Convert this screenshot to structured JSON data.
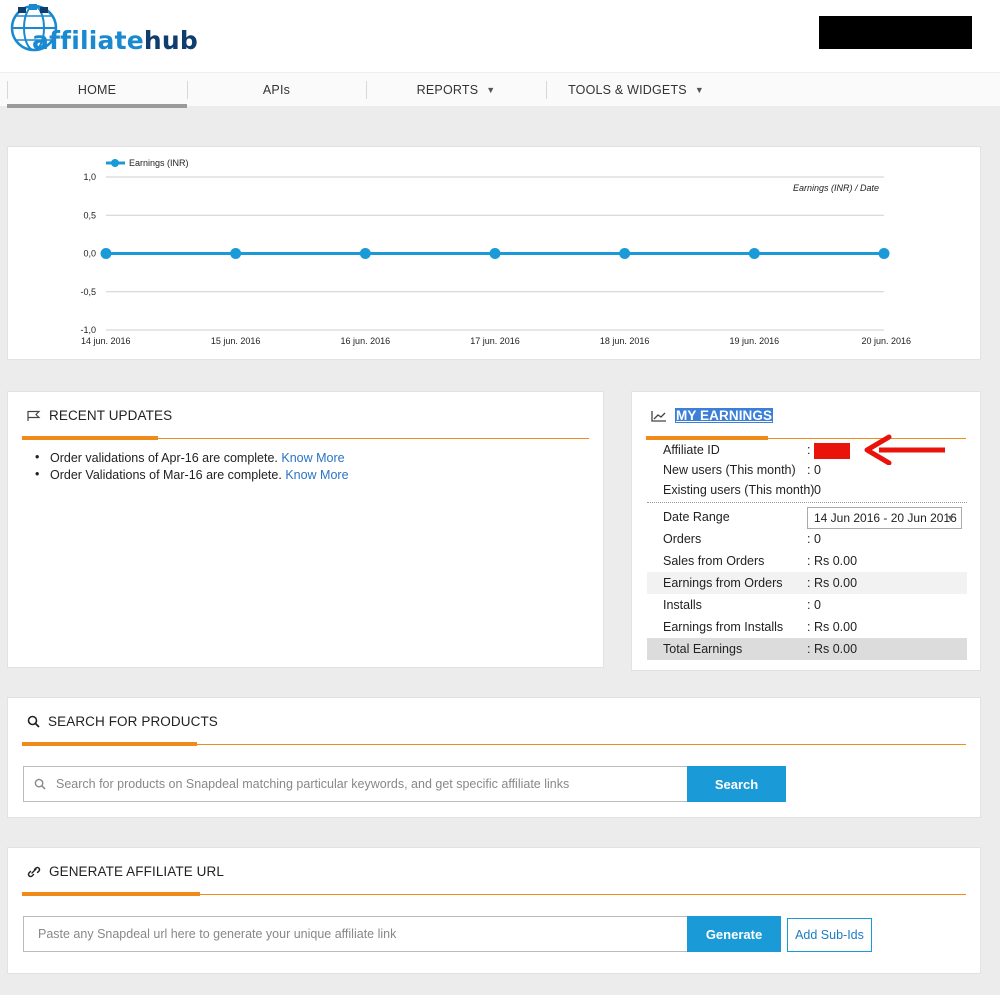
{
  "brand": {
    "aff": "affiliate",
    "hub": "hub"
  },
  "nav": {
    "items": [
      {
        "label": "HOME",
        "active": true
      },
      {
        "label": "APIs"
      },
      {
        "label": "REPORTS",
        "dropdown": true
      },
      {
        "label": "TOOLS & WIDGETS",
        "dropdown": true
      }
    ],
    "caret": "▼"
  },
  "chart_data": {
    "type": "line",
    "title": "Earnings (INR) / Date",
    "categories": [
      "14 jun. 2016",
      "15 jun. 2016",
      "16 jun. 2016",
      "17 jun. 2016",
      "18 jun. 2016",
      "19 jun. 2016",
      "20 jun. 2016"
    ],
    "series": [
      {
        "name": "Earnings (INR)",
        "values": [
          0,
          0,
          0,
          0,
          0,
          0,
          0
        ]
      }
    ],
    "yticks": [
      "1,0",
      "0,5",
      "0,0",
      "-0,5",
      "-1,0"
    ],
    "ylim": [
      -1,
      1
    ],
    "grid": true,
    "legend": "top-left",
    "color": "#1b9ad8"
  },
  "updates": {
    "title": "RECENT UPDATES",
    "items": [
      {
        "text": "Order validations of Apr-16 are complete.",
        "link": "Know More"
      },
      {
        "text": "Order Validations of Mar-16 are complete.",
        "link": "Know More"
      }
    ]
  },
  "earnings": {
    "title": "MY EARNINGS",
    "affiliate_id_label": "Affiliate ID",
    "new_users_label": "New users (This month)",
    "new_users_value": ": 0",
    "existing_users_label": "Existing users (This month)",
    "existing_users_value": ": 0",
    "date_range_label": "Date Range",
    "date_range_value": "14 Jun 2016 - 20 Jun 2016",
    "orders_label": "Orders",
    "orders_value": ": 0",
    "sales_label": "Sales from Orders",
    "sales_value": ": Rs 0.00",
    "earn_orders_label": "Earnings from Orders",
    "earn_orders_value": ": Rs 0.00",
    "installs_label": "Installs",
    "installs_value": ": 0",
    "earn_installs_label": "Earnings from Installs",
    "earn_installs_value": ": Rs 0.00",
    "total_label": "Total Earnings",
    "total_value": ": Rs 0.00"
  },
  "search": {
    "title": "SEARCH FOR PRODUCTS",
    "placeholder": "Search for products on Snapdeal matching particular keywords, and get specific affiliate links",
    "button": "Search"
  },
  "generate": {
    "title": "GENERATE AFFILIATE URL",
    "placeholder": "Paste any Snapdeal url here to generate your unique affiliate link",
    "button": "Generate",
    "subids_button": "Add Sub-Ids"
  }
}
